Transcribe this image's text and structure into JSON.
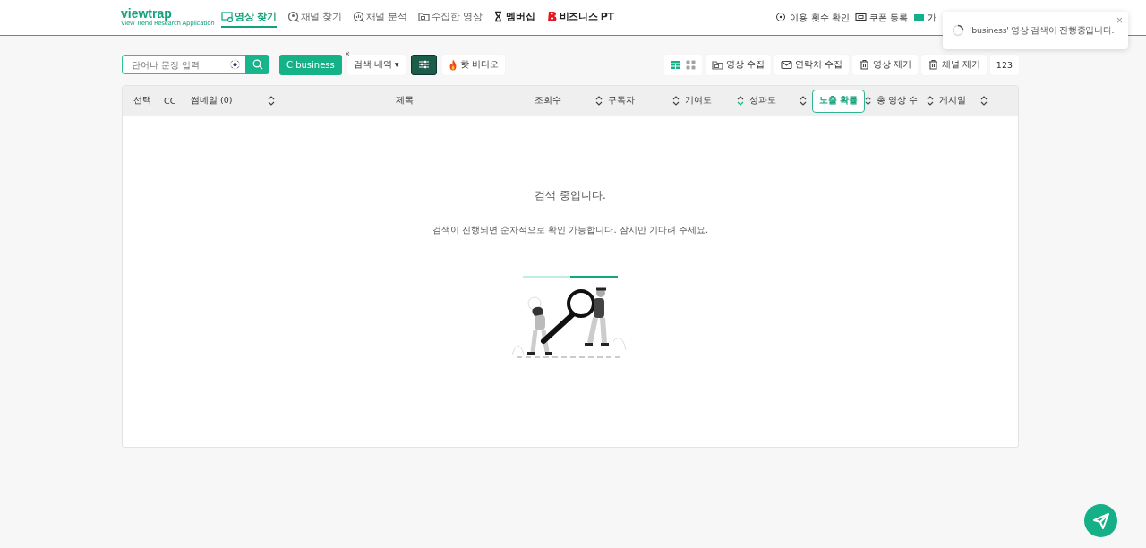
{
  "header": {
    "logo": "viewtrap",
    "logo_tagline": "View Trend Research Application",
    "nav": [
      {
        "label": "영상 찾기",
        "selected": true
      },
      {
        "label": "채널 찾기",
        "selected": false
      },
      {
        "label": "채널 분석",
        "selected": false
      },
      {
        "label": "수집한 영상",
        "selected": false
      },
      {
        "label": "멤버십",
        "selected": false
      },
      {
        "label": "비즈니스 PT",
        "selected": false
      }
    ],
    "actions": [
      {
        "label": "이용 횟수 확인"
      },
      {
        "label": "쿠폰 등록"
      },
      {
        "label": "가"
      }
    ]
  },
  "toast": {
    "message": "'business' 영상 검색이 진행중입니다.",
    "close": "×"
  },
  "toolbar": {
    "search": {
      "placeholder": "단어나 문장 입력"
    },
    "keyword_chip": {
      "label": "C business",
      "close": "×"
    },
    "history": {
      "label": "검색 내역 ▾"
    },
    "hot_video": {
      "label": "핫 비디오"
    },
    "view_toggle": [
      {
        "selected": true
      },
      {
        "selected": false
      }
    ],
    "buttons": [
      {
        "label": "영상 수집"
      },
      {
        "label": "연락처 수집"
      },
      {
        "label": "영상 제거"
      },
      {
        "label": "채널 제거"
      },
      {
        "label": "123"
      }
    ]
  },
  "table": {
    "columns": [
      {
        "label": "선택",
        "kind": "plain"
      },
      {
        "label": "CC",
        "kind": "plain"
      },
      {
        "label": "썸네일 (0)",
        "kind": "sortable",
        "sorted_desc": false
      },
      {
        "label": "제목",
        "kind": "plain"
      },
      {
        "label": "조회수",
        "kind": "sortable",
        "sorted_desc": false
      },
      {
        "label": "구독자",
        "kind": "sortable",
        "sorted_desc": false
      },
      {
        "label": "기여도",
        "kind": "sortable",
        "sorted_desc": true
      },
      {
        "label": "성과도",
        "kind": "sortable",
        "sorted_desc": false
      },
      {
        "label": "노출 확률",
        "kind": "button",
        "sorted_desc": false
      },
      {
        "label": "총 영상 수",
        "kind": "sortable",
        "sorted_desc": false
      },
      {
        "label": "게시일",
        "kind": "sortable",
        "sorted_desc": false
      }
    ],
    "empty": {
      "title": "검색 중입니다.",
      "message": "검색이 진행되면 순차적으로 확인 가능합니다. 잠시만 기다려 주세요."
    }
  }
}
